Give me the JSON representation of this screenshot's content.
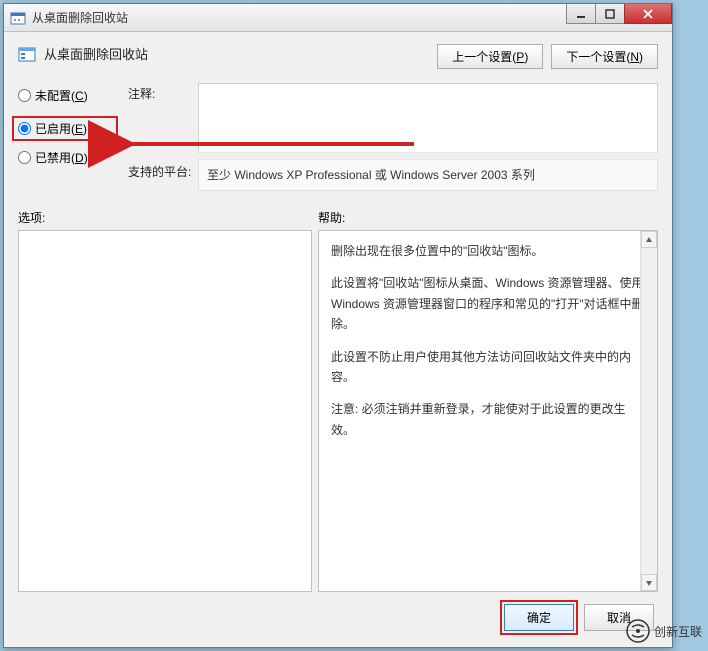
{
  "window": {
    "title": "从桌面删除回收站"
  },
  "header": {
    "title": "从桌面删除回收站"
  },
  "nav": {
    "prev": "上一个设置",
    "prev_key": "P",
    "next": "下一个设置",
    "next_key": "N"
  },
  "radios": {
    "not_configured": "未配置",
    "not_configured_key": "C",
    "enabled": "已启用",
    "enabled_key": "E",
    "disabled": "已禁用",
    "disabled_key": "D",
    "selected": "enabled"
  },
  "labels": {
    "comment": "注释:",
    "platform": "支持的平台:",
    "options": "选项:",
    "help": "帮助:"
  },
  "platform_text": "至少 Windows XP Professional 或 Windows Server 2003 系列",
  "help": {
    "p1": "删除出现在很多位置中的\"回收站\"图标。",
    "p2": "此设置将\"回收站\"图标从桌面、Windows 资源管理器、使用 Windows 资源管理器窗口的程序和常见的\"打开\"对话框中删除。",
    "p3": "此设置不防止用户使用其他方法访问回收站文件夹中的内容。",
    "p4": "注意: 必须注销并重新登录，才能使对于此设置的更改生效。"
  },
  "buttons": {
    "ok": "确定",
    "cancel": "取消"
  },
  "watermark": "创新互联"
}
